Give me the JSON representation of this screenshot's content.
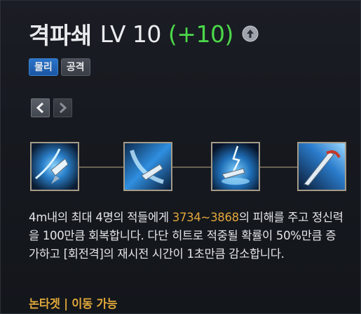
{
  "skill": {
    "name": "격파쇄",
    "level": "LV 10",
    "bonus": "(+10)"
  },
  "icons": {
    "upgrade": "arrow-up-circle-icon",
    "prev": "chevron-left-icon",
    "next": "chevron-right-icon"
  },
  "tags": [
    {
      "label": "물리",
      "color": "#2a74c9"
    },
    {
      "label": "공격",
      "color": "#4a4f57"
    }
  ],
  "combo_chain": [
    {
      "name": "skill-icon-1"
    },
    {
      "name": "skill-icon-2"
    },
    {
      "name": "skill-icon-3"
    },
    {
      "name": "skill-icon-4"
    }
  ],
  "description": {
    "part1": "4m내의 최대 4명의 적들에게 ",
    "damage": "3734~3868",
    "part2": "의 피해를 주고 정신력을 100만큼 회복합니다. 다단 히트로 적중될 확률이 50%만큼 증가하고 [회전격]의 재시전 시간이 1초만큼 감소합니다."
  },
  "footer": {
    "label": "논타겟 | 이동 가능"
  },
  "colors": {
    "bonus": "#4cd84a",
    "highlight": "#e2a63b",
    "footer": "#e0a83a",
    "frame": "#a59b88"
  }
}
